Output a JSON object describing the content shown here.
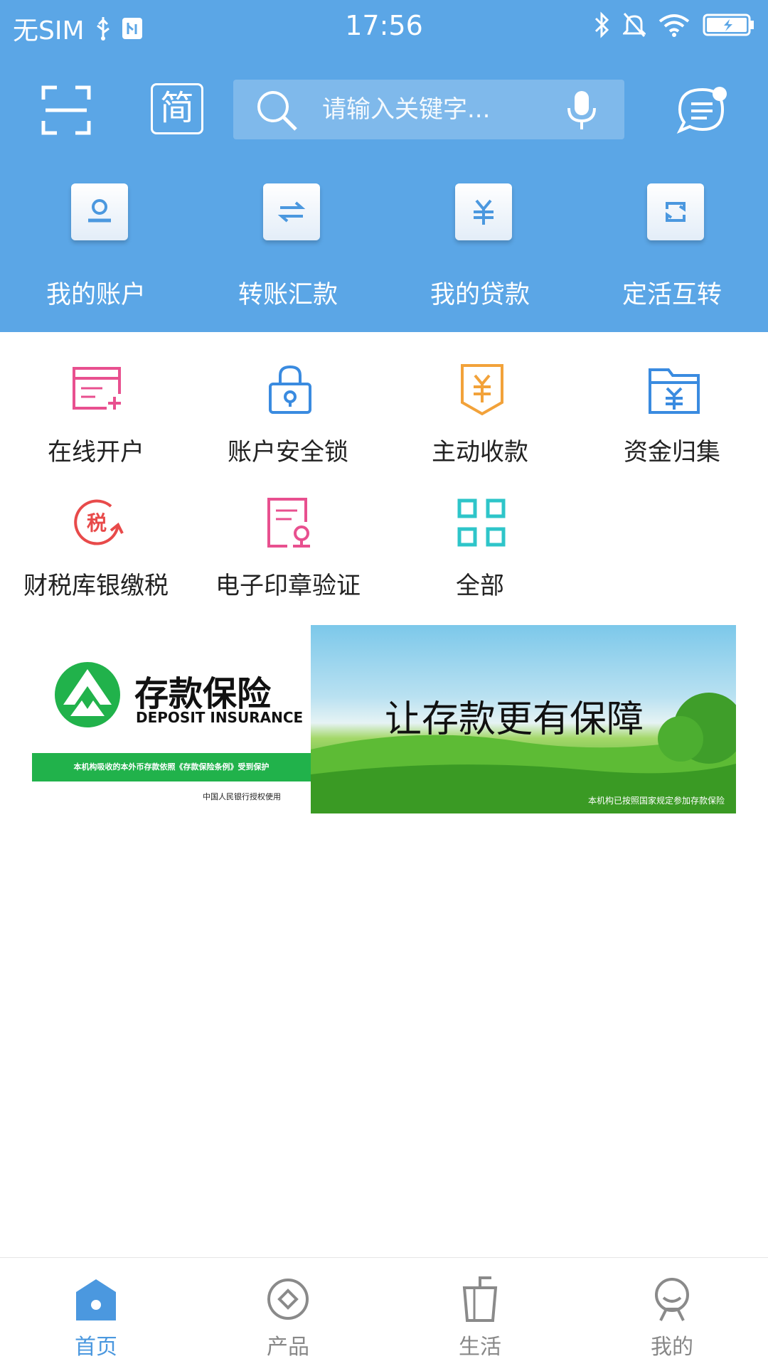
{
  "status_bar": {
    "carrier": "无SIM",
    "time": "17:56"
  },
  "header": {
    "simple_mode_label": "简",
    "search": {
      "placeholder": "请输入关键字..."
    }
  },
  "quick_actions": [
    {
      "label": "我的账户",
      "icon": "account-icon"
    },
    {
      "label": "转账汇款",
      "icon": "transfer-icon"
    },
    {
      "label": "我的贷款",
      "icon": "loan-icon"
    },
    {
      "label": "定活互转",
      "icon": "deposit-switch-icon"
    }
  ],
  "services": [
    {
      "label": "在线开户",
      "icon": "open-account-icon",
      "color": "#e8508f"
    },
    {
      "label": "账户安全锁",
      "icon": "security-lock-icon",
      "color": "#3a8be0"
    },
    {
      "label": "主动收款",
      "icon": "collection-icon",
      "color": "#f2a23a"
    },
    {
      "label": "资金归集",
      "icon": "fund-pool-icon",
      "color": "#3a8be0"
    },
    {
      "label": "财税库银缴税",
      "icon": "tax-icon",
      "color": "#e84a4a"
    },
    {
      "label": "电子印章验证",
      "icon": "seal-verify-icon",
      "color": "#e8508f"
    },
    {
      "label": "全部",
      "icon": "all-grid-icon",
      "color": "#2ec5c9"
    }
  ],
  "banner": {
    "brand_title": "存款保险",
    "brand_subtitle": "DEPOSIT INSURANCE",
    "green_bar_text": "本机构吸收的本外币存款依照《存款保险条例》受到保护",
    "authorized_text": "中国人民银行授权使用",
    "slogan": "让存款更有保障",
    "footnote": "本机构已按照国家规定参加存款保险"
  },
  "bottom_nav": [
    {
      "label": "首页",
      "icon": "home-icon",
      "active": true
    },
    {
      "label": "产品",
      "icon": "product-icon",
      "active": false
    },
    {
      "label": "生活",
      "icon": "life-icon",
      "active": false
    },
    {
      "label": "我的",
      "icon": "profile-icon",
      "active": false
    }
  ],
  "colors": {
    "header_blue": "#5ba6e6",
    "active_tab": "#4b98df",
    "insurance_green": "#21b24b"
  }
}
